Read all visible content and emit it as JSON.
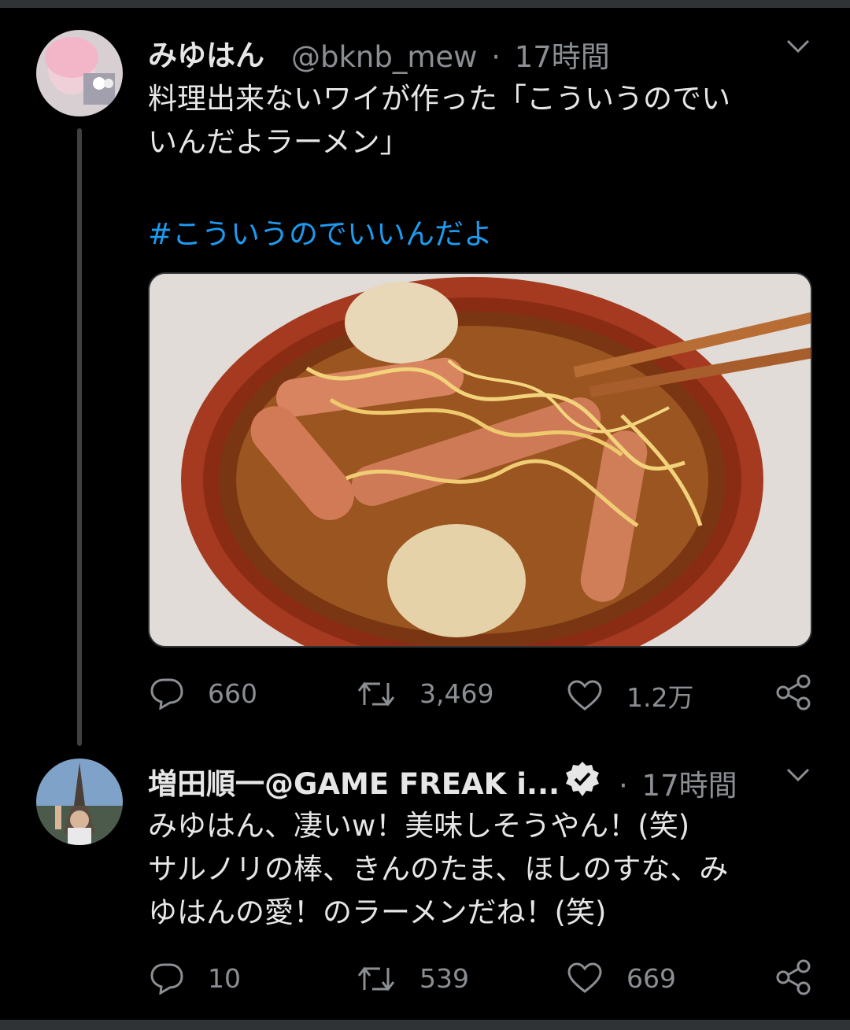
{
  "colors": {
    "background": "#000000",
    "text": "#e6e6e6",
    "muted": "#8b8f94",
    "link": "#1d9bf0"
  },
  "tweets": [
    {
      "display_name": "みゆはん",
      "handle": "@bknb_mew",
      "separator": "·",
      "time": "17時間",
      "text": "料理出来ないワイが作った「こういうのでい\nいんだよラーメン」",
      "hashtag": "#こういうのでいいんだよ",
      "media": "ramen-photo",
      "actions": {
        "reply": "660",
        "retweet": "3,469",
        "like": "1.2万"
      }
    },
    {
      "display_name": "増田順一@GAME FREAK i...",
      "verified": true,
      "separator": "·",
      "time": "17時間",
      "text": "みゆはん、凄いw！美味しそうやん！(笑)\nサルノリの棒、きんのたま、ほしのすな、み\nゆはんの愛！のラーメンだね！(笑)",
      "actions": {
        "reply": "10",
        "retweet": "539",
        "like": "669"
      }
    }
  ],
  "icons": [
    "reply-icon",
    "retweet-icon",
    "like-icon",
    "share-icon",
    "chevron-down-icon",
    "verified-badge-icon"
  ]
}
